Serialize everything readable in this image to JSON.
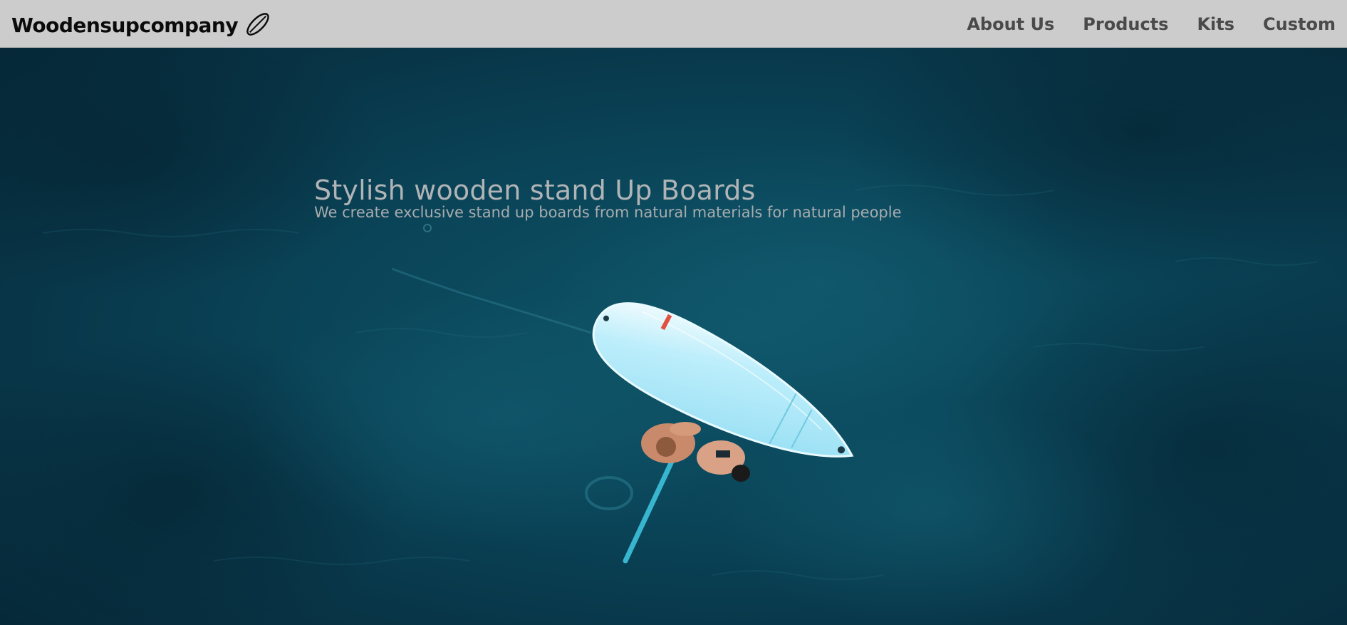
{
  "brand": {
    "name": "Woodensupcompany",
    "icon": "surfboard-icon"
  },
  "nav": {
    "items": [
      {
        "label": "About Us"
      },
      {
        "label": "Products"
      },
      {
        "label": "Kits"
      },
      {
        "label": "Custom"
      }
    ]
  },
  "hero": {
    "title": "Stylish wooden stand Up Boards",
    "subtitle": "We create exclusive stand up boards from natural materials for natural people",
    "image": "aerial-ocean-paddleboard-photo"
  },
  "colors": {
    "navbar_bg": "#cccccc",
    "brand_text": "#0b0b0b",
    "nav_text": "#4a4a4a",
    "ocean_dark": "#072b3a",
    "ocean_mid": "#0c4a5e",
    "board": "#8fdcf2",
    "hero_text": "#b0b4b6"
  }
}
